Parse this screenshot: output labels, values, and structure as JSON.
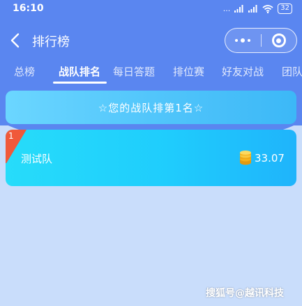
{
  "status_bar": {
    "time": "16:10",
    "network": "...",
    "battery": "32"
  },
  "nav": {
    "title": "排行榜"
  },
  "tabs": [
    {
      "label": "总榜"
    },
    {
      "label": "战队排名"
    },
    {
      "label": "每日答题"
    },
    {
      "label": "排位赛"
    },
    {
      "label": "好友对战"
    },
    {
      "label": "团队"
    }
  ],
  "active_tab": 1,
  "banner": {
    "text": "☆您的战队排第1名☆"
  },
  "team": {
    "rank": "1",
    "name": "测试队",
    "score": "33.07"
  },
  "watermark": {
    "text": "搜狐号@越讯科技"
  },
  "colors": {
    "header_blue": "#5a86f0",
    "page_bg": "#c9ddfb",
    "card_cyan": "#1fcdfd",
    "rank_corner": "#f0593a",
    "coin_gold": "#f5b21c"
  },
  "icons": {
    "back": "back-arrow-icon",
    "more": "more-dots-icon",
    "close": "target-close-icon",
    "coin": "coin-stack-icon"
  }
}
